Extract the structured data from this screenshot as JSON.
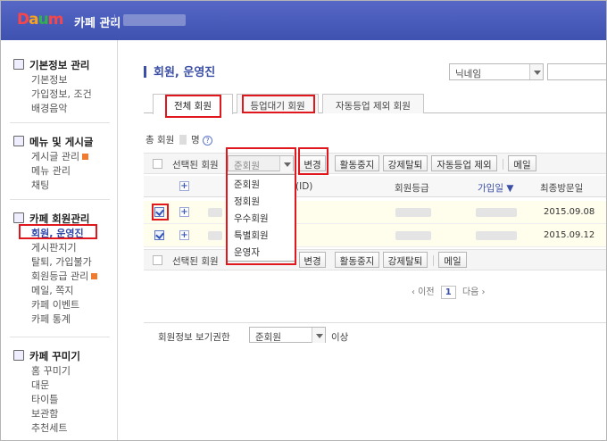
{
  "header": {
    "logo": {
      "letters": [
        "D",
        "a",
        "u",
        "m"
      ],
      "colors": [
        "#f7464a",
        "#f7a321",
        "#30b14c",
        "#f7464a"
      ]
    },
    "title": "카페 관리"
  },
  "sidebar": {
    "sections": [
      {
        "title": "기본정보 관리",
        "items": [
          "기본정보",
          "가입정보, 조건",
          "배경음악"
        ]
      },
      {
        "title": "메뉴 및 게시글",
        "items": [
          "게시글 관리",
          "메뉴 관리",
          "채팅"
        ]
      },
      {
        "title": "카페 회원관리",
        "items": [
          "회원, 운영진",
          "게시판지기",
          "탈퇴, 가입불가",
          "회원등급 관리",
          "메일, 쪽지",
          "카페 이벤트",
          "카페 통계"
        ]
      },
      {
        "title": "카페 꾸미기",
        "items": [
          "홈 꾸미기",
          "대문",
          "타이틀",
          "보관함",
          "추천세트"
        ]
      }
    ]
  },
  "main": {
    "title": "회원, 운영진",
    "search_select": "닉네임",
    "tabs": [
      "전체 회원",
      "등업대기 회원",
      "자동등업 제외 회원"
    ],
    "count": {
      "prefix": "총 회원",
      "suffix": "명",
      "help": "?"
    },
    "action": {
      "selected_label": "선택된 회원",
      "grade_select": "준회원",
      "buttons": [
        "변경",
        "활동중지",
        "강제탈퇴",
        "자동등업 제외",
        "메일"
      ],
      "bottom_buttons": [
        "변경",
        "활동중지",
        "강제탈퇴",
        "메일"
      ]
    },
    "table": {
      "columns": [
        "(ID)",
        "회원등급",
        "가입일 ▼",
        "최종방문일"
      ],
      "rows": [
        {
          "last_visit": "2015.09.08",
          "checked": true
        },
        {
          "last_visit": "2015.09.12",
          "checked": true
        }
      ]
    },
    "dropdown_options": [
      "준회원",
      "정회원",
      "우수회원",
      "특별회원",
      "운영자"
    ],
    "pager": {
      "prev": "‹ 이전",
      "page": "1",
      "next": "다음 ›"
    },
    "footer": {
      "label": "회원정보 보기권한",
      "select": "준회원",
      "suffix": "이상"
    }
  },
  "accent_color": "#e0171c"
}
